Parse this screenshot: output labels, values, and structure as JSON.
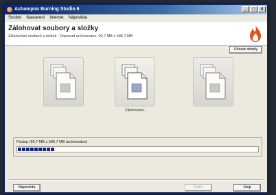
{
  "window": {
    "title": "Ashampoo Burning Studio 6",
    "controls": [
      "_",
      "□",
      "×"
    ]
  },
  "menu": [
    "Soubor",
    "Nastavení",
    "Internet",
    "Nápověda"
  ],
  "header": {
    "title": "Zálohovat soubory a složky",
    "subtitle": "Zálohování souborů a složek - Doposud archivováno: 90.7 MB z 586.7 MB"
  },
  "details_button": "Ukázat detaily",
  "cards": [
    {
      "label": ""
    },
    {
      "label": "Zálohování..."
    },
    {
      "label": ""
    }
  ],
  "progress": {
    "label": "Postup (90.7 MB z 586.7 MB archivováno)",
    "fraction": 0.155
  },
  "footer": {
    "help": "Nápověda",
    "next": "Další",
    "stop": "Stop"
  },
  "colors": {
    "progress_fill": "#16238c",
    "title_bar": "#0a246a",
    "flame": "#e0521d"
  },
  "icons": {
    "card": "document-stack-icon",
    "brand": "flame-icon"
  }
}
